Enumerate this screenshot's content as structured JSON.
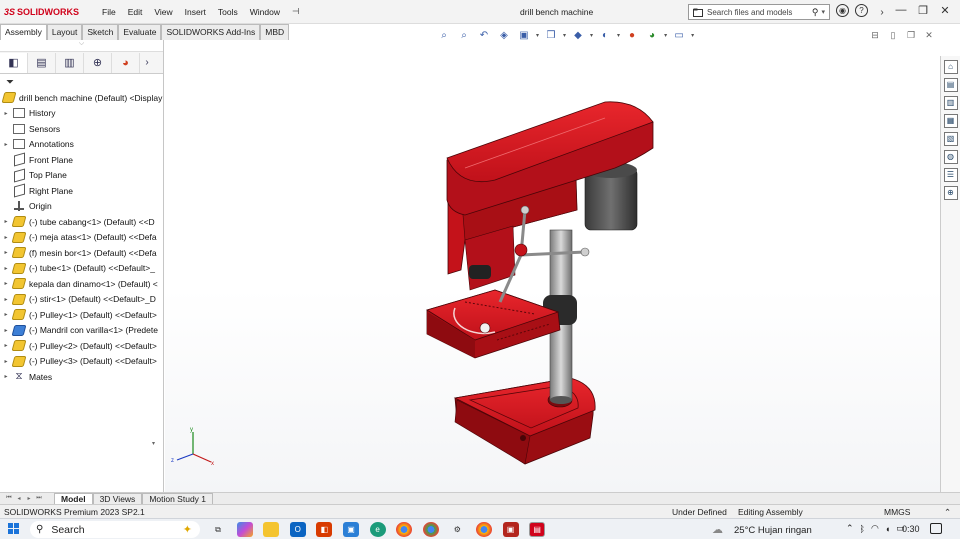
{
  "app": {
    "logo_ds": "3S",
    "brand": "SOLIDWORKS",
    "document_title": "drill bench machine"
  },
  "menu": [
    "File",
    "Edit",
    "View",
    "Insert",
    "Tools",
    "Window"
  ],
  "search": {
    "placeholder": "Search files and models"
  },
  "command_tabs": [
    "Assembly",
    "Layout",
    "Sketch",
    "Evaluate",
    "SOLIDWORKS Add-Ins",
    "MBD"
  ],
  "feature_tree": {
    "root": "drill bench machine (Default) <Display",
    "items": [
      {
        "label": "History",
        "icon": "history-folder",
        "expandable": true
      },
      {
        "label": "Sensors",
        "icon": "sensors-folder",
        "expandable": false
      },
      {
        "label": "Annotations",
        "icon": "annotations-folder",
        "expandable": true
      },
      {
        "label": "Front Plane",
        "icon": "plane",
        "expandable": false
      },
      {
        "label": "Top Plane",
        "icon": "plane",
        "expandable": false
      },
      {
        "label": "Right Plane",
        "icon": "plane",
        "expandable": false
      },
      {
        "label": "Origin",
        "icon": "origin",
        "expandable": false
      },
      {
        "label": "(-) tube cabang<1> (Default) <<D",
        "icon": "part",
        "expandable": true
      },
      {
        "label": "(-) meja atas<1> (Default) <<Defa",
        "icon": "part",
        "expandable": true
      },
      {
        "label": "(f) mesin bor<1> (Default) <<Defa",
        "icon": "part",
        "expandable": true
      },
      {
        "label": "(-) tube<1> (Default) <<Default>_",
        "icon": "part",
        "expandable": true
      },
      {
        "label": "kepala dan dinamo<1> (Default) <",
        "icon": "part",
        "expandable": true
      },
      {
        "label": "(-) stir<1> (Default) <<Default>_D",
        "icon": "part",
        "expandable": true
      },
      {
        "label": "(-) Pulley<1> (Default) <<Default>",
        "icon": "part",
        "expandable": true
      },
      {
        "label": "(-) Mandril con varilla<1> (Predete",
        "icon": "part-blue",
        "expandable": true
      },
      {
        "label": "(-) Pulley<2> (Default) <<Default>",
        "icon": "part",
        "expandable": true
      },
      {
        "label": "(-) Pulley<3> (Default) <<Default>",
        "icon": "part",
        "expandable": true
      },
      {
        "label": "Mates",
        "icon": "mates",
        "expandable": true
      }
    ]
  },
  "bottom_tabs": [
    "Model",
    "3D Views",
    "Motion Study 1"
  ],
  "status": {
    "product": "SOLIDWORKS Premium 2023 SP2.1",
    "definition": "Under Defined",
    "mode": "Editing Assembly",
    "units": "MMGS"
  },
  "taskbar": {
    "search_label": "Search",
    "weather": "25°C  Hujan ringan",
    "time": "0:30"
  },
  "colors": {
    "model_red": "#d4141a",
    "model_dark": "#7a0a0e",
    "brand_red": "#d0021b"
  }
}
